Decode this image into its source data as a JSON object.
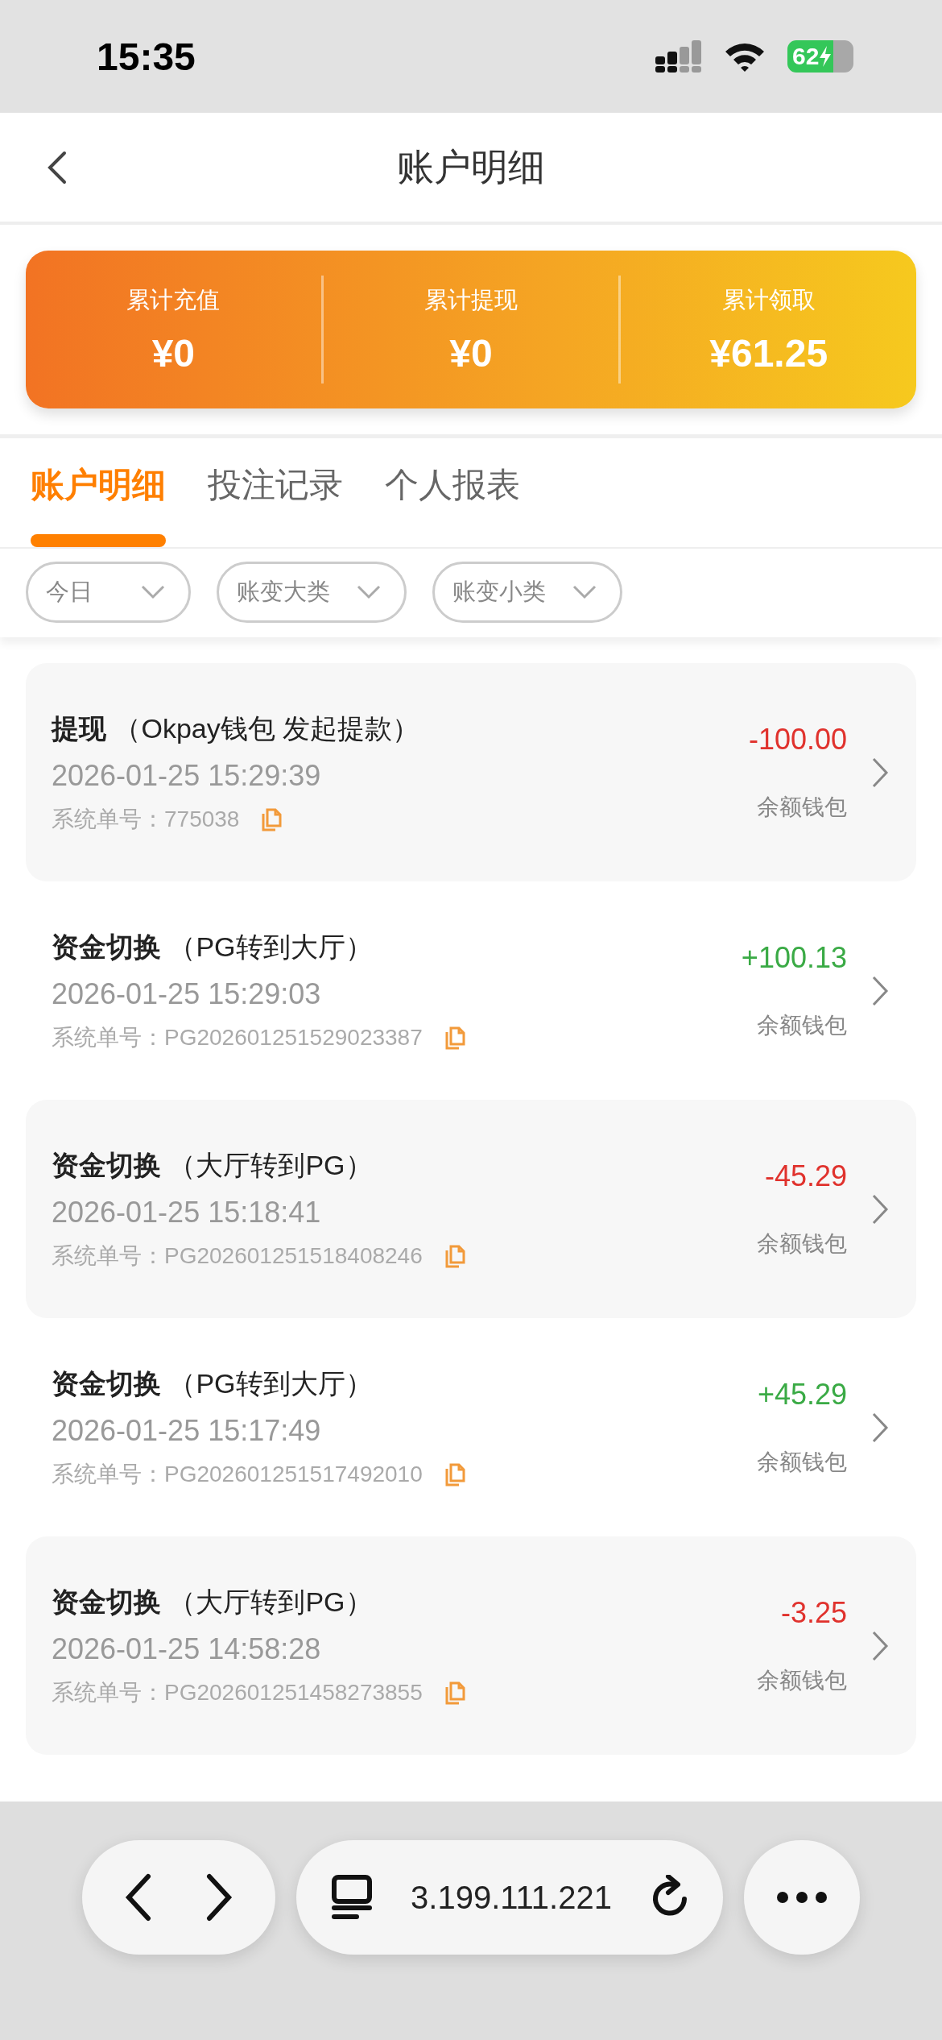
{
  "status_bar": {
    "time": "15:35",
    "battery": "62"
  },
  "header": {
    "title": "账户明细"
  },
  "summary": [
    {
      "label": "累计充值",
      "value": "¥0"
    },
    {
      "label": "累计提现",
      "value": "¥0"
    },
    {
      "label": "累计领取",
      "value": "¥61.25"
    }
  ],
  "tabs": [
    {
      "label": "账户明细",
      "selected": true
    },
    {
      "label": "投注记录",
      "selected": false
    },
    {
      "label": "个人报表",
      "selected": false
    }
  ],
  "filters": [
    {
      "label": "今日"
    },
    {
      "label": "账变大类"
    },
    {
      "label": "账变小类"
    }
  ],
  "records": [
    {
      "type": "提现",
      "detail": "（Okpay钱包 发起提款）",
      "time": "2026-01-25 15:29:39",
      "order_label": "系统单号：",
      "order_no": "775038",
      "amount": "-100.00",
      "kind": "out",
      "wallet": "余额钱包"
    },
    {
      "type": "资金切换",
      "detail": "（PG转到大厅）",
      "time": "2026-01-25 15:29:03",
      "order_label": "系统单号：",
      "order_no": "PG202601251529023387",
      "amount": "+100.13",
      "kind": "in",
      "wallet": "余额钱包"
    },
    {
      "type": "资金切换",
      "detail": "（大厅转到PG）",
      "time": "2026-01-25 15:18:41",
      "order_label": "系统单号：",
      "order_no": "PG202601251518408246",
      "amount": "-45.29",
      "kind": "out",
      "wallet": "余额钱包"
    },
    {
      "type": "资金切换",
      "detail": "（PG转到大厅）",
      "time": "2026-01-25 15:17:49",
      "order_label": "系统单号：",
      "order_no": "PG202601251517492010",
      "amount": "+45.29",
      "kind": "in",
      "wallet": "余额钱包"
    },
    {
      "type": "资金切换",
      "detail": "（大厅转到PG）",
      "time": "2026-01-25 14:58:28",
      "order_label": "系统单号：",
      "order_no": "PG202601251458273855",
      "amount": "-3.25",
      "kind": "out",
      "wallet": "余额钱包"
    }
  ],
  "browser": {
    "address": "3.199.111.221"
  }
}
